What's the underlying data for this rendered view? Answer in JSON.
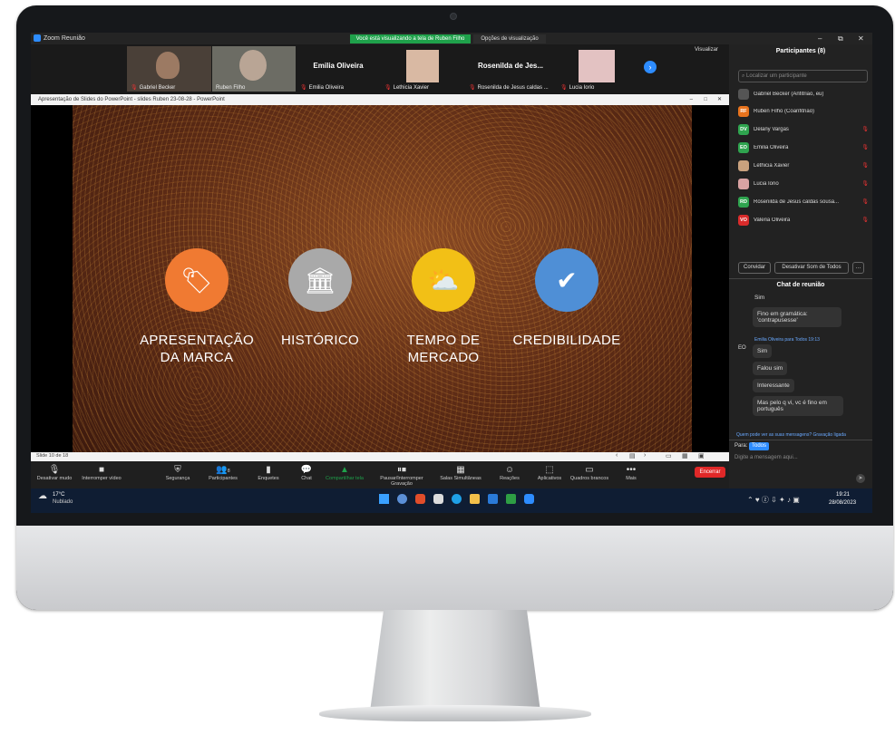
{
  "zoom": {
    "window_title": "Zoom Reunião",
    "banner": "Você está visualizando a tela de Ruben Filho",
    "view_options": "Opções de visualização",
    "view_button": "Visualizar"
  },
  "participants_strip": [
    {
      "name": "Gabriel Becker"
    },
    {
      "name": "Ruben Filho"
    },
    {
      "name": "Emilia Oliveira",
      "big_name": "Emilia Oliveira"
    },
    {
      "name": "Lethicia Xavier"
    },
    {
      "name": "Rosenilda de Jesus caldas ...",
      "big_name": "Rosenilda de Jes..."
    },
    {
      "name": "Lucia Iorio"
    }
  ],
  "ppt": {
    "title": "Apresentação de Slides do PowerPoint - slides Ruben 23-08-28 - PowerPoint",
    "slide_counter": "Slide 10 de 18",
    "items": [
      {
        "label_line1": "APRESENTAÇÃO",
        "label_line2": "DA MARCA",
        "color": "#F07A32",
        "icon": "tag-icon"
      },
      {
        "label_line1": "HISTÓRICO",
        "label_line2": "",
        "color": "#A9A9A9",
        "icon": "bank-icon"
      },
      {
        "label_line1": "TEMPO DE",
        "label_line2": "MERCADO",
        "color": "#F2C016",
        "icon": "weather-icon"
      },
      {
        "label_line1": "CREDIBILIDADE",
        "label_line2": "",
        "color": "#4F8FD6",
        "icon": "check-icon"
      }
    ]
  },
  "toolbar": {
    "mute": "Desativar mudo",
    "stop_video": "Interromper vídeo",
    "security": "Segurança",
    "participants": "Participantes",
    "participants_count": "8",
    "polls": "Enquetes",
    "chat": "Chat",
    "share": "Compartilhar tela",
    "record": "Pausar/Interromper Gravação",
    "breakout": "Salas Simultâneas",
    "reactions": "Reações",
    "apps": "Aplicativos",
    "whiteboards": "Quadros brancos",
    "more": "Mais",
    "end": "Encerrar"
  },
  "panel": {
    "title": "Participantes (8)",
    "search_placeholder": "Localizar um participante",
    "list": [
      {
        "initials": "",
        "name": "Gabriel Becker (Anfitrião, eu)",
        "color": "#555555"
      },
      {
        "initials": "RF",
        "name": "Ruben Filho (Coanfitrião)",
        "color": "#E8731D"
      },
      {
        "initials": "DV",
        "name": "Delany Vargas",
        "color": "#2FA44F"
      },
      {
        "initials": "EO",
        "name": "Emilia Oliveira",
        "color": "#2FA44F"
      },
      {
        "initials": "",
        "name": "Lethicia Xavier",
        "color": "#C9A27E"
      },
      {
        "initials": "",
        "name": "Lucia Iorio",
        "color": "#D9A3A3"
      },
      {
        "initials": "RD",
        "name": "Rosenilda de Jesus caldas sousa...",
        "color": "#2FA44F"
      },
      {
        "initials": "VO",
        "name": "Valeria Oliveira",
        "color": "#D92B2B"
      }
    ],
    "invite": "Convidar",
    "mute_all": "Desativar Som de Todos",
    "chat_title": "Chat de reunião",
    "messages": [
      {
        "text": "Sim"
      },
      {
        "text": "Fino em gramática: 'contrapusesse'"
      },
      {
        "text": "Sim"
      },
      {
        "text": "Falou sim"
      },
      {
        "text": "Interessante"
      },
      {
        "text": "Mas pelo q vi, vc é fino em português"
      }
    ],
    "chat_sender": "Emilia Oliveira para Todos 19:13",
    "chat_sender_initials": "EO",
    "who_can_see": "Quem pode ver as suas mensagens? Gravação ligada",
    "to_label": "Para:",
    "to_value": "Todos",
    "message_placeholder": "Digite a mensagem aqui..."
  },
  "taskbar": {
    "temp": "17°C",
    "weather": "Nublado",
    "time": "19:21",
    "date": "28/08/2023"
  }
}
